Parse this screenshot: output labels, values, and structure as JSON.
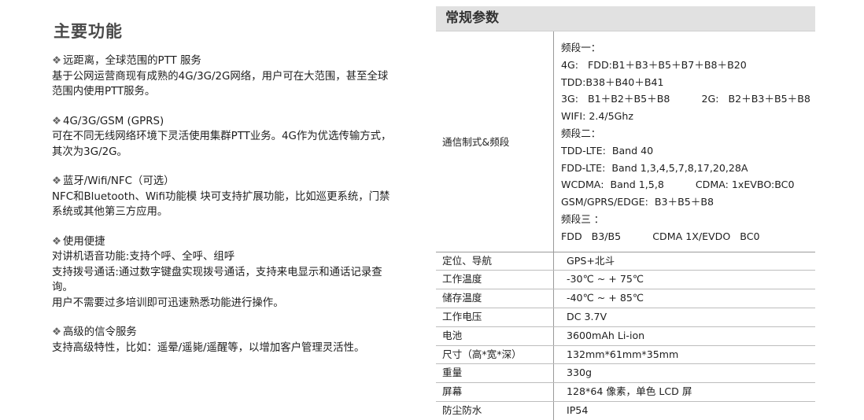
{
  "left": {
    "title": "主要功能",
    "features": [
      {
        "title": "远距离，全球范围的PTT 服务",
        "body": "基于公网运营商现有成熟的4G/3G/2G网络，用户可在大范围，甚至全球范围内使用PTT服务。"
      },
      {
        "title": "4G/3G/GSM (GPRS)",
        "body": "可在不同无线网络环境下灵活使用集群PTT业务。4G作为优选传输方式，其次为3G/2G。"
      },
      {
        "title": "蓝牙/Wifi/NFC（可选）",
        "body": "NFC和Bluetooth、Wifi功能模 块可支持扩展功能，比如巡更系统，门禁系统或其他第三方应用。"
      },
      {
        "title": "使用便捷",
        "body": "对讲机语音功能:支持个呼、全呼、组呼\n支持拨号通话:通过数字键盘实现拨号通话，支持来电显示和通话记录查询。\n用户不需要过多培训即可迅速熟悉功能进行操作。"
      },
      {
        "title": "高级的信令服务",
        "body": "支持高级特性，比如：遥晕/遥毙/遥醒等，以增加客户管理灵活性。"
      }
    ]
  },
  "right": {
    "header": "常规参数",
    "band": {
      "label": "通信制式&频段",
      "lines": [
        "频段一：",
        "4G:   FDD:B1＋B3＋B5＋B7＋B8＋B20",
        "TDD:B38＋B40＋B41",
        "3G:   B1＋B2＋B5＋B8          2G:   B2＋B3＋B5＋B8",
        "WIFI: 2.4/5Ghz",
        "频段二：",
        "TDD-LTE:  Band 40",
        "FDD-LTE:  Band 1,3,4,5,7,8,17,20,28A",
        "WCDMA:  Band 1,5,8          CDMA: 1xEVBO:BC0",
        "GSM/GPRS/EDGE:  B3＋B5＋B8",
        "频段三 ：",
        "FDD   B3/B5          CDMA 1X/EVDO   BC0"
      ]
    },
    "specs": [
      {
        "label": "定位、导航",
        "value": "GPS+北斗"
      },
      {
        "label": "工作温度",
        "value": "-30℃ ~ + 75℃"
      },
      {
        "label": "储存温度",
        "value": "-40℃ ~ + 85℃"
      },
      {
        "label": "工作电压",
        "value": "DC 3.7V"
      },
      {
        "label": "电池",
        "value": "3600mAh Li-ion"
      },
      {
        "label": "尺寸（高*宽*深）",
        "value": "132mm*61mm*35mm"
      },
      {
        "label": "重量",
        "value": "330g"
      },
      {
        "label": "屏幕",
        "value": "128*64 像素，单色 LCD 屏"
      },
      {
        "label": "防尘防水",
        "value": "IP54"
      }
    ]
  }
}
